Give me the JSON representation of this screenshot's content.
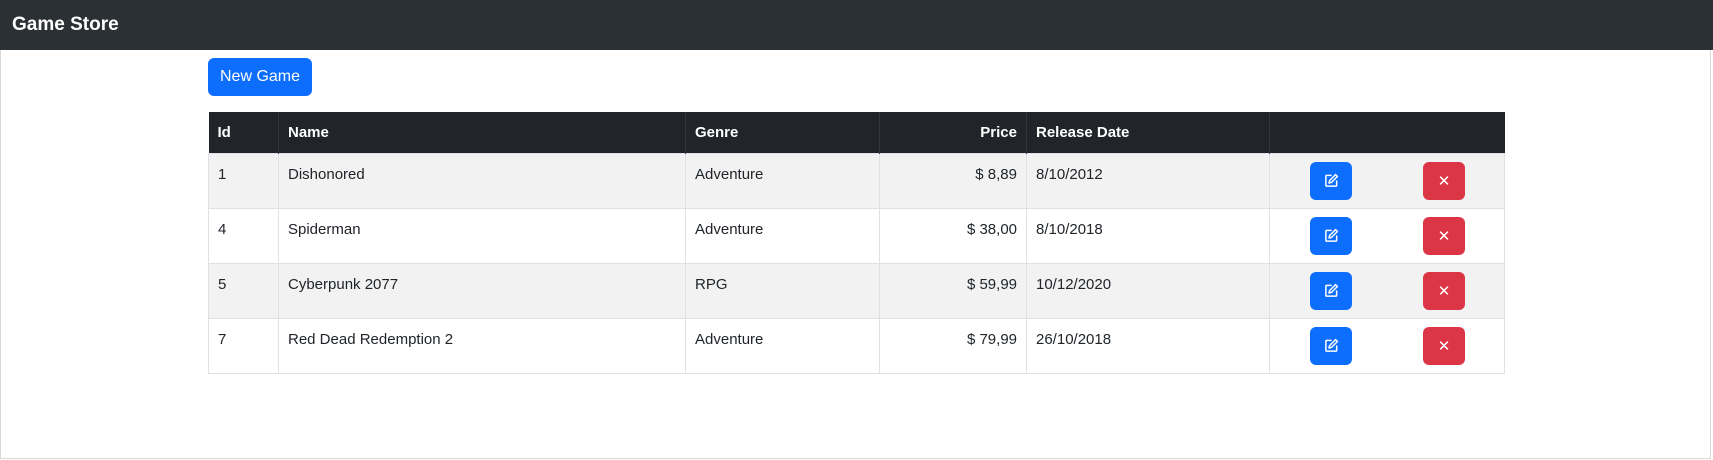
{
  "navbar": {
    "brand": "Game Store"
  },
  "toolbar": {
    "new_label": "New Game"
  },
  "table": {
    "headers": {
      "id": "Id",
      "name": "Name",
      "genre": "Genre",
      "price": "Price",
      "release_date": "Release Date",
      "actions": ""
    },
    "rows": [
      {
        "id": "1",
        "name": "Dishonored",
        "genre": "Adventure",
        "price": "$ 8,89",
        "release_date": "8/10/2012"
      },
      {
        "id": "4",
        "name": "Spiderman",
        "genre": "Adventure",
        "price": "$ 38,00",
        "release_date": "8/10/2018"
      },
      {
        "id": "5",
        "name": "Cyberpunk 2077",
        "genre": "RPG",
        "price": "$ 59,99",
        "release_date": "10/12/2020"
      },
      {
        "id": "7",
        "name": "Red Dead Redemption 2",
        "genre": "Adventure",
        "price": "$ 79,99",
        "release_date": "26/10/2018"
      }
    ],
    "delete_glyph": "✕",
    "edit_icon": "pencil-square-icon",
    "delete_icon": "x-icon"
  },
  "colors": {
    "navbar": "#2b3035",
    "primary": "#0d6efd",
    "danger": "#dc3545",
    "table_header": "#212529",
    "stripe": "#f2f2f2"
  }
}
